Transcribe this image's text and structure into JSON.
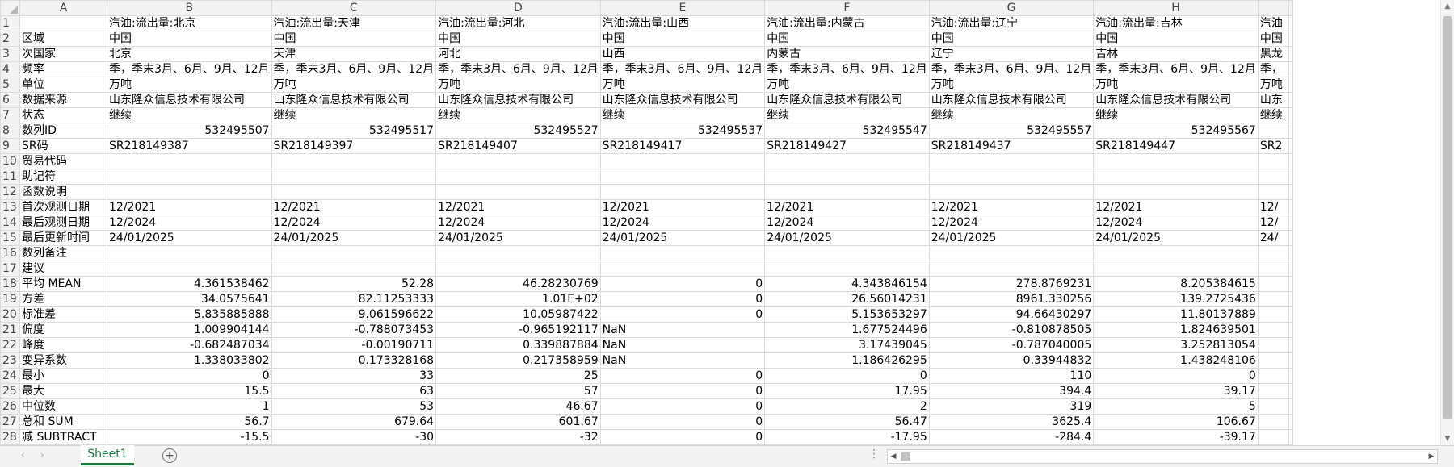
{
  "columns": [
    "A",
    "B",
    "C",
    "D",
    "E",
    "F",
    "G",
    "H",
    ""
  ],
  "rows": [
    {
      "n": "1",
      "cells": [
        "",
        "汽油:流出量:北京",
        "汽油:流出量:天津",
        "汽油:流出量:河北",
        "汽油:流出量:山西",
        "汽油:流出量:内蒙古",
        "汽油:流出量:辽宁",
        "汽油:流出量:吉林",
        "汽油"
      ]
    },
    {
      "n": "2",
      "cells": [
        "区域",
        "中国",
        "中国",
        "中国",
        "中国",
        "中国",
        "中国",
        "中国",
        "中国"
      ]
    },
    {
      "n": "3",
      "cells": [
        "次国家",
        "北京",
        "天津",
        "河北",
        "山西",
        "内蒙古",
        "辽宁",
        "吉林",
        "黑龙"
      ]
    },
    {
      "n": "4",
      "cells": [
        "频率",
        "季，季末3月、6月、9月、12月",
        "季，季末3月、6月、9月、12月",
        "季，季末3月、6月、9月、12月",
        "季，季末3月、6月、9月、12月",
        "季，季末3月、6月、9月、12月",
        "季，季末3月、6月、9月、12月",
        "季，季末3月、6月、9月、12月",
        "季，"
      ]
    },
    {
      "n": "5",
      "cells": [
        "单位",
        "万吨",
        "万吨",
        "万吨",
        "万吨",
        "万吨",
        "万吨",
        "万吨",
        "万吨"
      ]
    },
    {
      "n": "6",
      "cells": [
        "数据来源",
        "山东隆众信息技术有限公司",
        "山东隆众信息技术有限公司",
        "山东隆众信息技术有限公司",
        "山东隆众信息技术有限公司",
        "山东隆众信息技术有限公司",
        "山东隆众信息技术有限公司",
        "山东隆众信息技术有限公司",
        "山东"
      ]
    },
    {
      "n": "7",
      "cells": [
        "状态",
        "继续",
        "继续",
        "继续",
        "继续",
        "继续",
        "继续",
        "继续",
        "继续"
      ]
    },
    {
      "n": "8",
      "cells": [
        "数列ID",
        "532495507",
        "532495517",
        "532495527",
        "532495537",
        "532495547",
        "532495557",
        "532495567",
        ""
      ],
      "num": true
    },
    {
      "n": "9",
      "cells": [
        "SR码",
        "SR218149387",
        "SR218149397",
        "SR218149407",
        "SR218149417",
        "SR218149427",
        "SR218149437",
        "SR218149447",
        "SR2"
      ]
    },
    {
      "n": "10",
      "cells": [
        "贸易代码",
        "",
        "",
        "",
        "",
        "",
        "",
        "",
        ""
      ]
    },
    {
      "n": "11",
      "cells": [
        "助记符",
        "",
        "",
        "",
        "",
        "",
        "",
        "",
        ""
      ]
    },
    {
      "n": "12",
      "cells": [
        "函数说明",
        "",
        "",
        "",
        "",
        "",
        "",
        "",
        ""
      ]
    },
    {
      "n": "13",
      "cells": [
        "首次观测日期",
        "12/2021",
        "12/2021",
        "12/2021",
        "12/2021",
        "12/2021",
        "12/2021",
        "12/2021",
        "12/"
      ]
    },
    {
      "n": "14",
      "cells": [
        "最后观测日期",
        "12/2024",
        "12/2024",
        "12/2024",
        "12/2024",
        "12/2024",
        "12/2024",
        "12/2024",
        "12/"
      ]
    },
    {
      "n": "15",
      "cells": [
        "最后更新时间",
        "24/01/2025",
        "24/01/2025",
        "24/01/2025",
        "24/01/2025",
        "24/01/2025",
        "24/01/2025",
        "24/01/2025",
        "24/"
      ]
    },
    {
      "n": "16",
      "cells": [
        "数列备注",
        "",
        "",
        "",
        "",
        "",
        "",
        "",
        ""
      ]
    },
    {
      "n": "17",
      "cells": [
        "建议",
        "",
        "",
        "",
        "",
        "",
        "",
        "",
        ""
      ]
    },
    {
      "n": "18",
      "cells": [
        "平均 MEAN",
        "4.361538462",
        "52.28",
        "46.28230769",
        "0",
        "4.343846154",
        "278.8769231",
        "8.205384615",
        ""
      ],
      "num": true
    },
    {
      "n": "19",
      "cells": [
        "方差",
        "34.0575641",
        "82.11253333",
        "1.01E+02",
        "0",
        "26.56014231",
        "8961.330256",
        "139.2725436",
        ""
      ],
      "num": true
    },
    {
      "n": "20",
      "cells": [
        "标准差",
        "5.835885888",
        "9.061596622",
        "10.05987422",
        "0",
        "5.153653297",
        "94.66430297",
        "11.80137889",
        ""
      ],
      "num": true
    },
    {
      "n": "21",
      "cells": [
        "偏度",
        "1.009904144",
        "-0.788073453",
        "-0.965192117",
        "NaN",
        "1.677524496",
        "-0.810878505",
        "1.824639501",
        ""
      ],
      "num": true,
      "nan": true
    },
    {
      "n": "22",
      "cells": [
        "峰度",
        "-0.682487034",
        "-0.00190711",
        "0.339887884",
        "NaN",
        "3.17439045",
        "-0.787040005",
        "3.252813054",
        ""
      ],
      "num": true,
      "nan": true
    },
    {
      "n": "23",
      "cells": [
        "变异系数",
        "1.338033802",
        "0.173328168",
        "0.217358959",
        "NaN",
        "1.186426295",
        "0.33944832",
        "1.438248106",
        ""
      ],
      "num": true,
      "nan": true
    },
    {
      "n": "24",
      "cells": [
        "最小",
        "0",
        "33",
        "25",
        "0",
        "0",
        "110",
        "0",
        ""
      ],
      "num": true
    },
    {
      "n": "25",
      "cells": [
        "最大",
        "15.5",
        "63",
        "57",
        "0",
        "17.95",
        "394.4",
        "39.17",
        ""
      ],
      "num": true
    },
    {
      "n": "26",
      "cells": [
        "中位数",
        "1",
        "53",
        "46.67",
        "0",
        "2",
        "319",
        "5",
        ""
      ],
      "num": true
    },
    {
      "n": "27",
      "cells": [
        "总和 SUM",
        "56.7",
        "679.64",
        "601.67",
        "0",
        "56.47",
        "3625.4",
        "106.67",
        ""
      ],
      "num": true
    },
    {
      "n": "28",
      "cells": [
        "减 SUBTRACT",
        "-15.5",
        "-30",
        "-32",
        "0",
        "-17.95",
        "-284.4",
        "-39.17",
        ""
      ],
      "num": true
    }
  ],
  "tabs": {
    "sheet_name": "Sheet1",
    "prev_icon": "‹",
    "next_icon": "›",
    "add_icon": "+",
    "more_icon": "⋮",
    "scroll_left_icon": "◀",
    "scroll_right_icon": "▶"
  },
  "scroll": {
    "up_icon": "▲",
    "down_icon": "▼"
  }
}
